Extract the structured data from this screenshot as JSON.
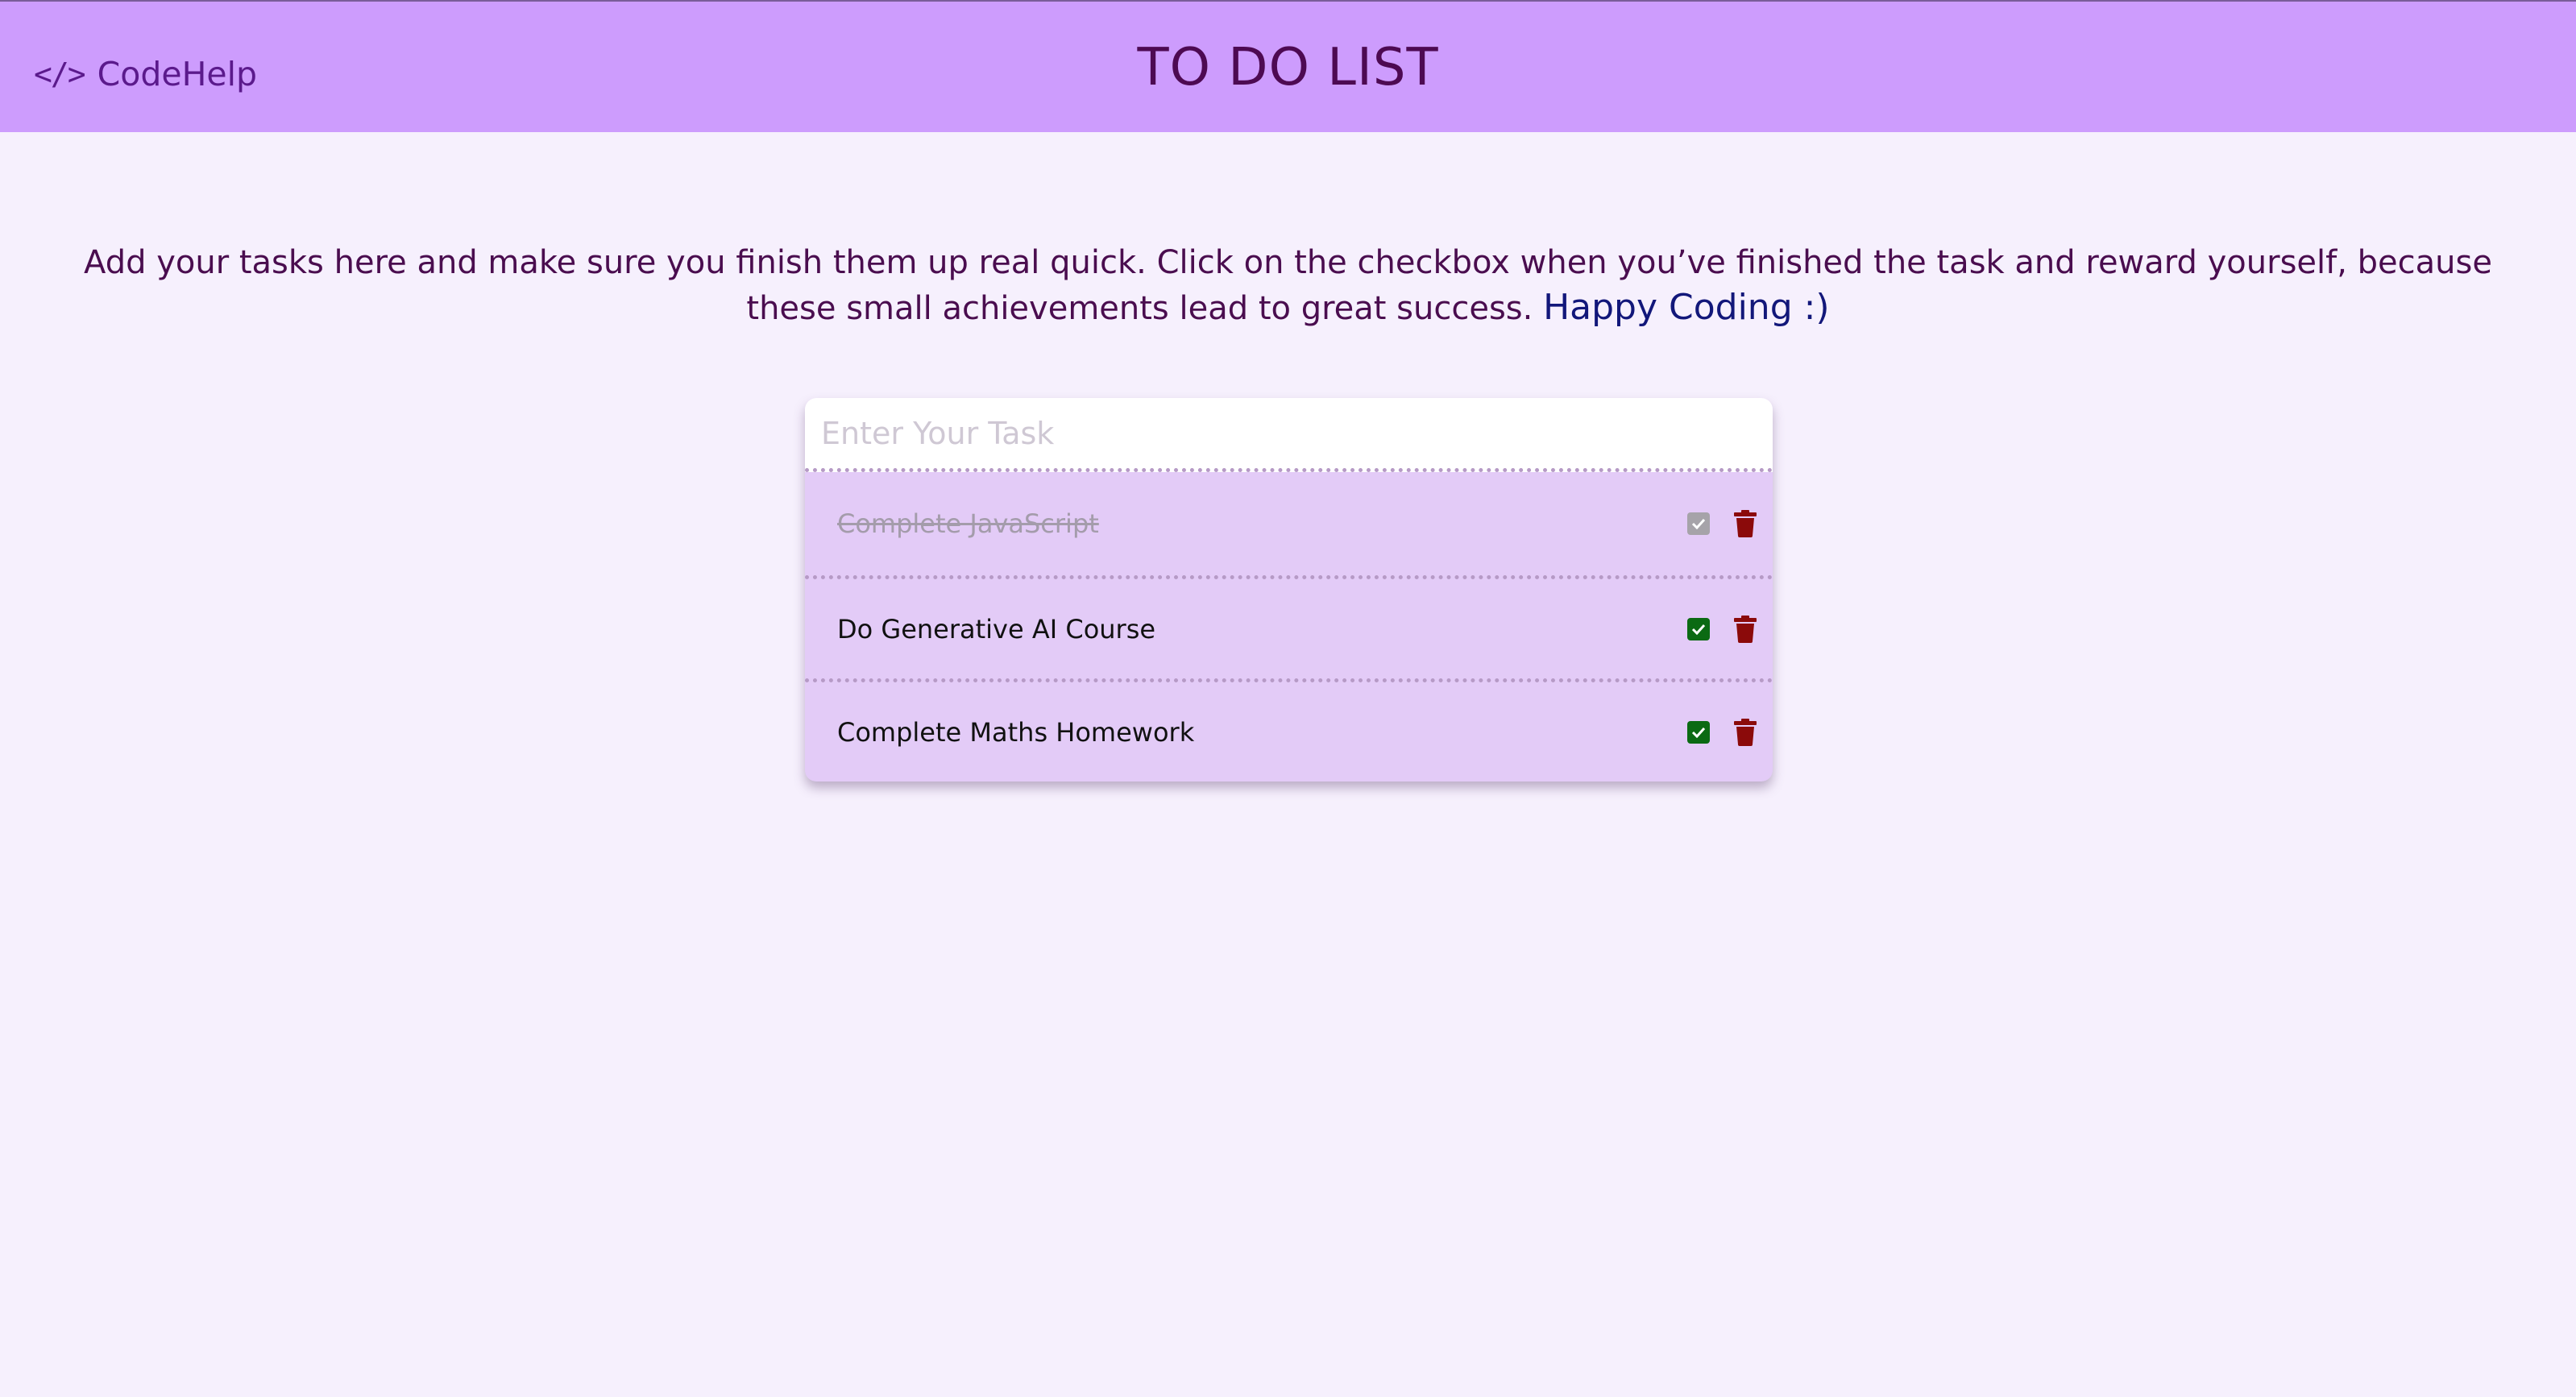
{
  "navbar": {
    "brand_icon": "</>",
    "brand_name": "CodeHelp",
    "title": "TO DO LIST"
  },
  "intro": {
    "text": "Add your tasks here and make sure you finish them up real quick. Click on the checkbox when you’ve finished the task and reward yourself, because these small achievements lead to great success.",
    "highlight": "Happy Coding :)"
  },
  "todo": {
    "input_placeholder": "Enter Your Task",
    "input_value": "",
    "tasks": [
      {
        "label": "Complete JavaScript",
        "completed": true
      },
      {
        "label": "Do Generative AI Course",
        "completed": false
      },
      {
        "label": "Complete Maths Homework",
        "completed": false
      }
    ]
  },
  "colors": {
    "navbar_bg": "#cd9cfd",
    "page_bg": "#f6f0fd",
    "card_bg": "#e3cbf7",
    "check_active": "#0b6a13",
    "check_done": "#a6a3a9",
    "trash": "#8b0a0a",
    "highlight_text": "#12177a"
  },
  "icons": {
    "brand": "code-brackets-icon",
    "check": "check-icon",
    "delete": "trash-icon"
  }
}
